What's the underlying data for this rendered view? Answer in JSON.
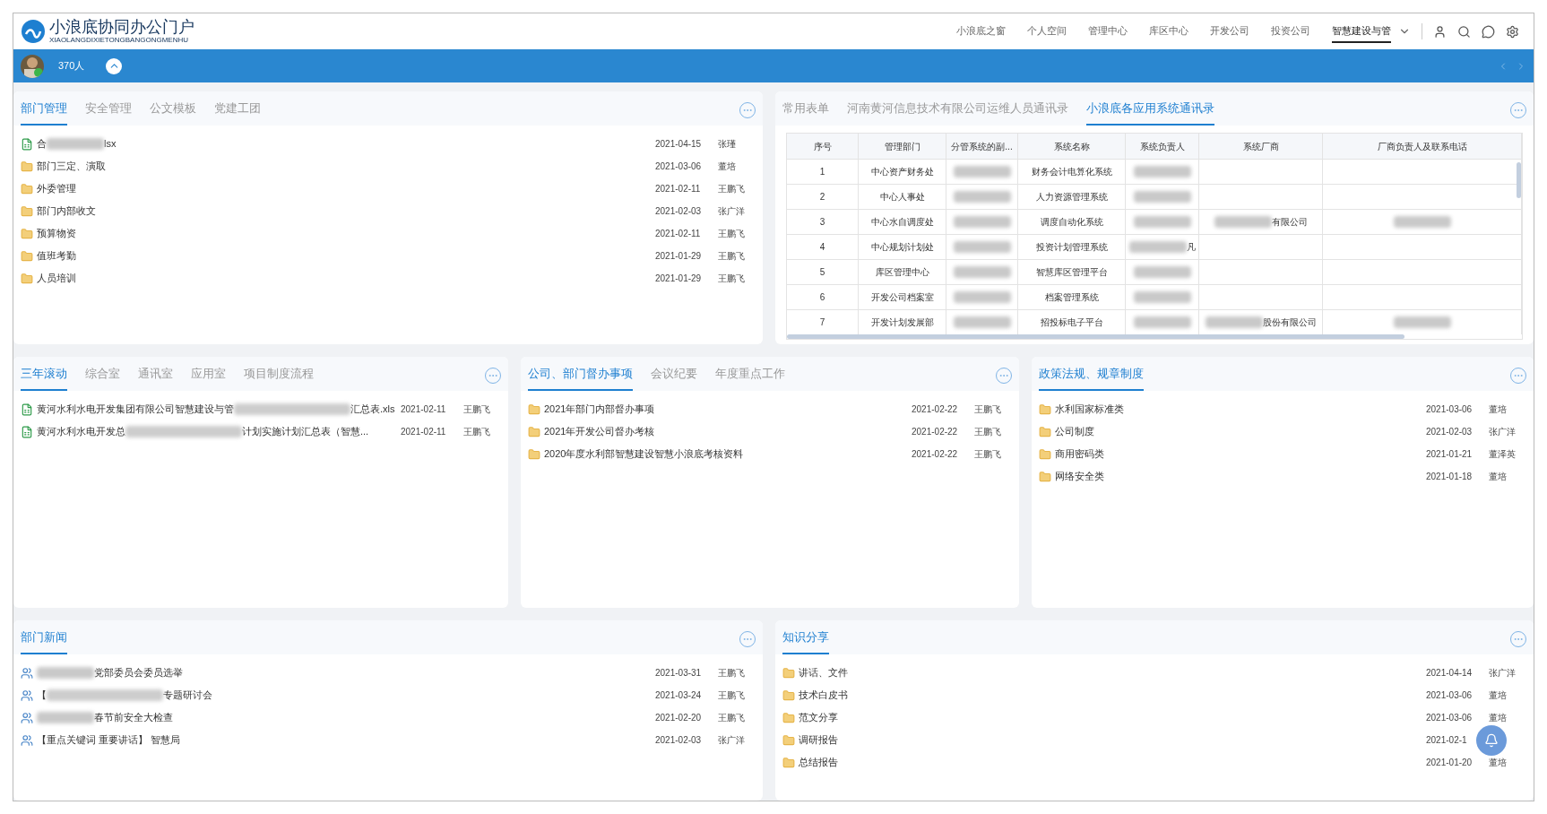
{
  "header": {
    "title": "小浪底协同办公门户",
    "subtitle": "XIAOLANGDIXIETONGBANGONGMENHU",
    "nav": [
      {
        "label": "小浪底之窗",
        "selected": false
      },
      {
        "label": "个人空间",
        "selected": false
      },
      {
        "label": "管理中心",
        "selected": false
      },
      {
        "label": "库区中心",
        "selected": false
      },
      {
        "label": "开发公司",
        "selected": false
      },
      {
        "label": "投资公司",
        "selected": false
      },
      {
        "label": "智慧建设与管",
        "selected": true
      }
    ]
  },
  "bar": {
    "count": "370人"
  },
  "panel_docs": {
    "tabs": [
      {
        "label": "部门管理",
        "selected": true
      },
      {
        "label": "安全管理",
        "selected": false
      },
      {
        "label": "公文模板",
        "selected": false
      },
      {
        "label": "党建工团",
        "selected": false
      }
    ],
    "rows": [
      {
        "kind": "excel",
        "title": [
          {
            "kind": "text",
            "text": "合"
          },
          {
            "kind": "blur"
          },
          {
            "kind": "text",
            "text": "lsx"
          }
        ],
        "date": "2021-04-15",
        "author": "张瑾"
      },
      {
        "kind": "folder",
        "title": [
          {
            "kind": "text",
            "text": "部门三定、演取"
          }
        ],
        "date": "2021-03-06",
        "author": "董培"
      },
      {
        "kind": "folder",
        "title": [
          {
            "kind": "text",
            "text": "外委管理"
          }
        ],
        "date": "2021-02-11",
        "author": "王鹏飞"
      },
      {
        "kind": "folder",
        "title": [
          {
            "kind": "text",
            "text": "部门内部收文"
          }
        ],
        "date": "2021-02-03",
        "author": "张广洋"
      },
      {
        "kind": "folder",
        "title": [
          {
            "kind": "text",
            "text": "预算物资"
          }
        ],
        "date": "2021-02-11",
        "author": "王鹏飞"
      },
      {
        "kind": "folder",
        "title": [
          {
            "kind": "text",
            "text": "值班考勤"
          }
        ],
        "date": "2021-01-29",
        "author": "王鹏飞"
      },
      {
        "kind": "folder",
        "title": [
          {
            "kind": "text",
            "text": "人员培训"
          }
        ],
        "date": "2021-01-29",
        "author": "王鹏飞"
      }
    ]
  },
  "panel_table": {
    "tabs": [
      {
        "label": "常用表单",
        "selected": false
      },
      {
        "label": "河南黄河信息技术有限公司运维人员通讯录",
        "selected": false
      },
      {
        "label": "小浪底各应用系统通讯录",
        "selected": true
      }
    ],
    "columns": [
      "序号",
      "管理部门",
      "分管系统的副...",
      "系统名称",
      "系统负责人",
      "系统厂商",
      "厂商负责人及联系电话"
    ],
    "rows": [
      [
        [
          {
            "kind": "text",
            "text": "1"
          }
        ],
        [
          {
            "kind": "text",
            "text": "中心资产财务处"
          }
        ],
        [
          {
            "kind": "blur"
          }
        ],
        [
          {
            "kind": "text",
            "text": "财务会计电算化系统"
          }
        ],
        [
          {
            "kind": "blur"
          }
        ],
        [],
        []
      ],
      [
        [
          {
            "kind": "text",
            "text": "2"
          }
        ],
        [
          {
            "kind": "text",
            "text": "中心人事处"
          }
        ],
        [
          {
            "kind": "blur"
          }
        ],
        [
          {
            "kind": "text",
            "text": "人力资源管理系统"
          }
        ],
        [
          {
            "kind": "blur"
          }
        ],
        [],
        []
      ],
      [
        [
          {
            "kind": "text",
            "text": "3"
          }
        ],
        [
          {
            "kind": "text",
            "text": "中心水自调度处"
          }
        ],
        [
          {
            "kind": "blur"
          }
        ],
        [
          {
            "kind": "text",
            "text": "调度自动化系统"
          }
        ],
        [
          {
            "kind": "blur"
          }
        ],
        [
          {
            "kind": "blur"
          },
          {
            "kind": "text",
            "text": "有限公司"
          }
        ],
        [
          {
            "kind": "blur"
          }
        ]
      ],
      [
        [
          {
            "kind": "text",
            "text": "4"
          }
        ],
        [
          {
            "kind": "text",
            "text": "中心规划计划处"
          }
        ],
        [
          {
            "kind": "blur"
          }
        ],
        [
          {
            "kind": "text",
            "text": "投资计划管理系统"
          }
        ],
        [
          {
            "kind": "blur"
          },
          {
            "kind": "text",
            "text": "凡"
          }
        ],
        [],
        []
      ],
      [
        [
          {
            "kind": "text",
            "text": "5"
          }
        ],
        [
          {
            "kind": "text",
            "text": "库区管理中心"
          }
        ],
        [
          {
            "kind": "blur"
          }
        ],
        [
          {
            "kind": "text",
            "text": "智慧库区管理平台"
          }
        ],
        [
          {
            "kind": "blur"
          }
        ],
        [],
        []
      ],
      [
        [
          {
            "kind": "text",
            "text": "6"
          }
        ],
        [
          {
            "kind": "text",
            "text": "开发公司档案室"
          }
        ],
        [
          {
            "kind": "blur"
          }
        ],
        [
          {
            "kind": "text",
            "text": "档案管理系统"
          }
        ],
        [
          {
            "kind": "blur"
          }
        ],
        [],
        []
      ],
      [
        [
          {
            "kind": "text",
            "text": "7"
          }
        ],
        [
          {
            "kind": "text",
            "text": "开发计划发展部"
          }
        ],
        [
          {
            "kind": "blur"
          }
        ],
        [
          {
            "kind": "text",
            "text": "招投标电子平台"
          }
        ],
        [
          {
            "kind": "blur"
          }
        ],
        [
          {
            "kind": "blur"
          },
          {
            "kind": "text",
            "text": "股份有限公司"
          }
        ],
        [
          {
            "kind": "blur"
          }
        ]
      ]
    ]
  },
  "panel_plans": {
    "tabs": [
      {
        "label": "三年滚动",
        "selected": true
      },
      {
        "label": "综合室",
        "selected": false
      },
      {
        "label": "通讯室",
        "selected": false
      },
      {
        "label": "应用室",
        "selected": false
      },
      {
        "label": "项目制度流程",
        "selected": false
      }
    ],
    "rows": [
      {
        "kind": "excel",
        "title": [
          {
            "kind": "text",
            "text": "黄河水利水电开发集团有限公司智慧建设与管"
          },
          {
            "kind": "longblur"
          },
          {
            "kind": "text",
            "text": "汇总表.xls"
          }
        ],
        "date": "2021-02-11",
        "author": "王鹏飞"
      },
      {
        "kind": "excel",
        "title": [
          {
            "kind": "text",
            "text": "黄河水利水电开发总"
          },
          {
            "kind": "longblur"
          },
          {
            "kind": "text",
            "text": "计划实施计划汇总表（智慧..."
          }
        ],
        "date": "2021-02-11",
        "author": "王鹏飞"
      }
    ]
  },
  "panel_tasks": {
    "tabs": [
      {
        "label": "公司、部门督办事项",
        "selected": true
      },
      {
        "label": "会议纪要",
        "selected": false
      },
      {
        "label": "年度重点工作",
        "selected": false
      }
    ],
    "rows": [
      {
        "kind": "folder",
        "title": [
          {
            "kind": "text",
            "text": "2021年部门内部督办事项"
          }
        ],
        "date": "2021-02-22",
        "author": "王鹏飞"
      },
      {
        "kind": "folder",
        "title": [
          {
            "kind": "text",
            "text": "2021年开发公司督办考核"
          }
        ],
        "date": "2021-02-22",
        "author": "王鹏飞"
      },
      {
        "kind": "folder",
        "title": [
          {
            "kind": "text",
            "text": "2020年度水利部智慧建设智慧小浪底考核资料"
          }
        ],
        "date": "2021-02-22",
        "author": "王鹏飞"
      }
    ]
  },
  "panel_rules": {
    "tabs": [
      {
        "label": "政策法规、规章制度",
        "selected": true
      }
    ],
    "rows": [
      {
        "kind": "folder",
        "title": [
          {
            "kind": "text",
            "text": "水利国家标准类"
          }
        ],
        "date": "2021-03-06",
        "author": "董培"
      },
      {
        "kind": "folder",
        "title": [
          {
            "kind": "text",
            "text": "公司制度"
          }
        ],
        "date": "2021-02-03",
        "author": "张广洋"
      },
      {
        "kind": "folder",
        "title": [
          {
            "kind": "text",
            "text": "商用密码类"
          }
        ],
        "date": "2021-01-21",
        "author": "董泽英"
      },
      {
        "kind": "folder",
        "title": [
          {
            "kind": "text",
            "text": "网络安全类"
          }
        ],
        "date": "2021-01-18",
        "author": "董培"
      }
    ]
  },
  "panel_news": {
    "tabs": [
      {
        "label": "部门新闻",
        "selected": true
      }
    ],
    "rows": [
      {
        "kind": "person",
        "title": [
          {
            "kind": "blur"
          },
          {
            "kind": "text",
            "text": "党部委员会委员选举"
          }
        ],
        "date": "2021-03-31",
        "author": "王鹏飞"
      },
      {
        "kind": "person",
        "title": [
          {
            "kind": "text",
            "text": "【"
          },
          {
            "kind": "longblur"
          },
          {
            "kind": "text",
            "text": "专题研讨会"
          }
        ],
        "date": "2021-03-24",
        "author": "王鹏飞"
      },
      {
        "kind": "person",
        "title": [
          {
            "kind": "blur"
          },
          {
            "kind": "text",
            "text": "春节前安全大检查"
          }
        ],
        "date": "2021-02-20",
        "author": "王鹏飞"
      },
      {
        "kind": "person",
        "title": [
          {
            "kind": "text",
            "text": "【重点关键词 重要讲话】 智慧局"
          }
        ],
        "date": "2021-02-03",
        "author": "张广洋"
      }
    ]
  },
  "panel_share": {
    "tabs": [
      {
        "label": "知识分享",
        "selected": true
      }
    ],
    "rows": [
      {
        "kind": "folder",
        "title": [
          {
            "kind": "text",
            "text": "讲话、文件"
          }
        ],
        "date": "2021-04-14",
        "author": "张广洋"
      },
      {
        "kind": "folder",
        "title": [
          {
            "kind": "text",
            "text": "技术白皮书"
          }
        ],
        "date": "2021-03-06",
        "author": "董培"
      },
      {
        "kind": "folder",
        "title": [
          {
            "kind": "text",
            "text": "范文分享"
          }
        ],
        "date": "2021-03-06",
        "author": "董培"
      },
      {
        "kind": "folder",
        "title": [
          {
            "kind": "text",
            "text": "调研报告"
          }
        ],
        "date": "2021-02-1"
      },
      {
        "kind": "folder",
        "title": [
          {
            "kind": "text",
            "text": "总结报告"
          }
        ],
        "date": "2021-01-20",
        "author": "董培"
      }
    ]
  }
}
